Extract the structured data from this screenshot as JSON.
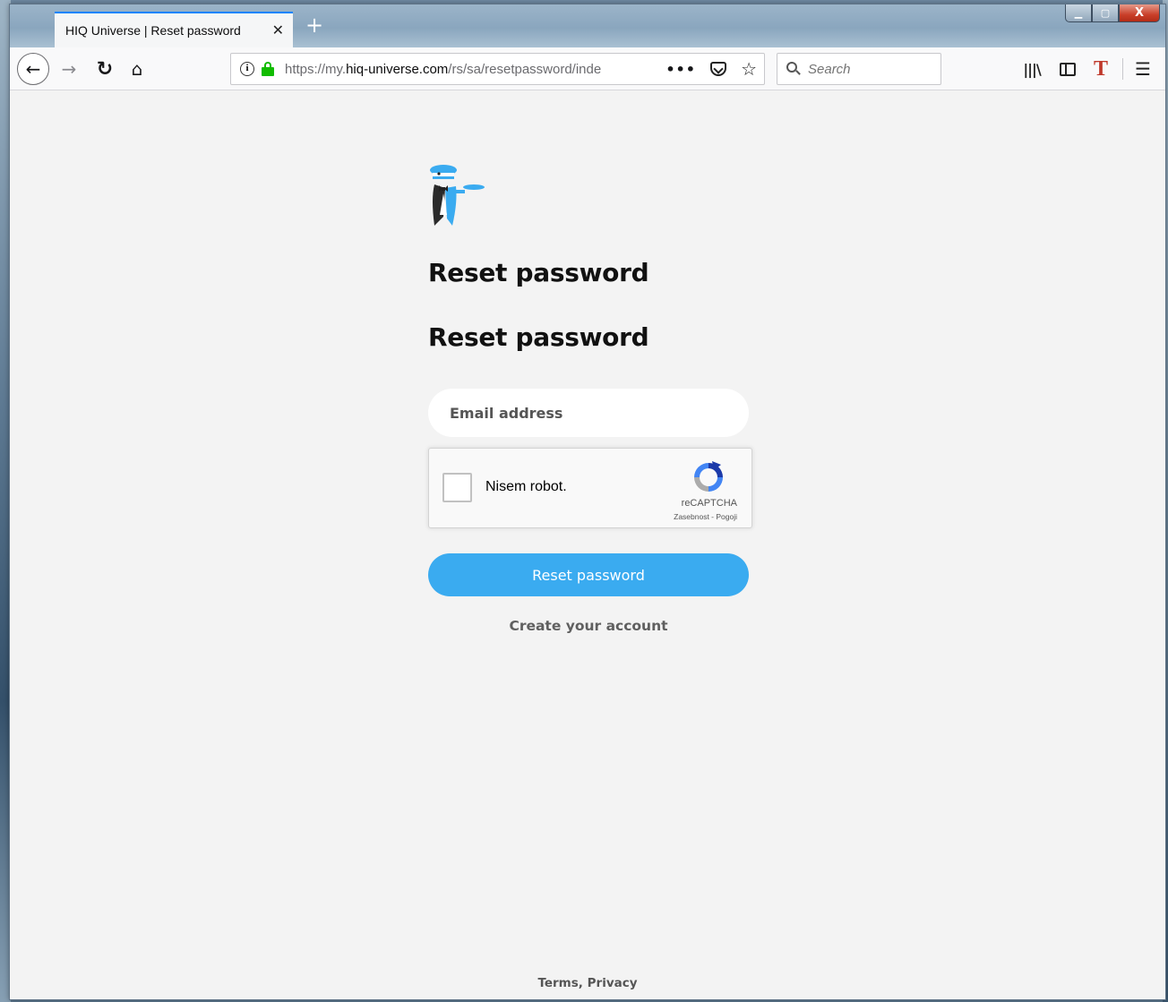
{
  "browser": {
    "tab_title": "HIQ Universe | Reset password",
    "tab_close": "✕",
    "new_tab": "+",
    "url_prefix": "https://my.",
    "url_domain": "hiq-universe.com",
    "url_path": "/rs/sa/resetpassword/inde",
    "url_more": "•••",
    "search_placeholder": "Search",
    "window_buttons": {
      "minimize": "▁",
      "maximize": "▢",
      "close": "X"
    }
  },
  "page": {
    "heading_1": "Reset password",
    "heading_2": "Reset password",
    "email_placeholder": "Email address",
    "captcha": {
      "label": "Nisem robot.",
      "brand": "reCAPTCHA",
      "links": "Zasebnost - Pogoji"
    },
    "reset_button": "Reset password",
    "create_account": "Create your account",
    "footer": {
      "terms": "Terms",
      "separator": ", ",
      "privacy": "Privacy"
    }
  },
  "colors": {
    "accent": "#3aabf0",
    "lock": "#12bc00",
    "tab_highlight": "#0a84ff"
  }
}
